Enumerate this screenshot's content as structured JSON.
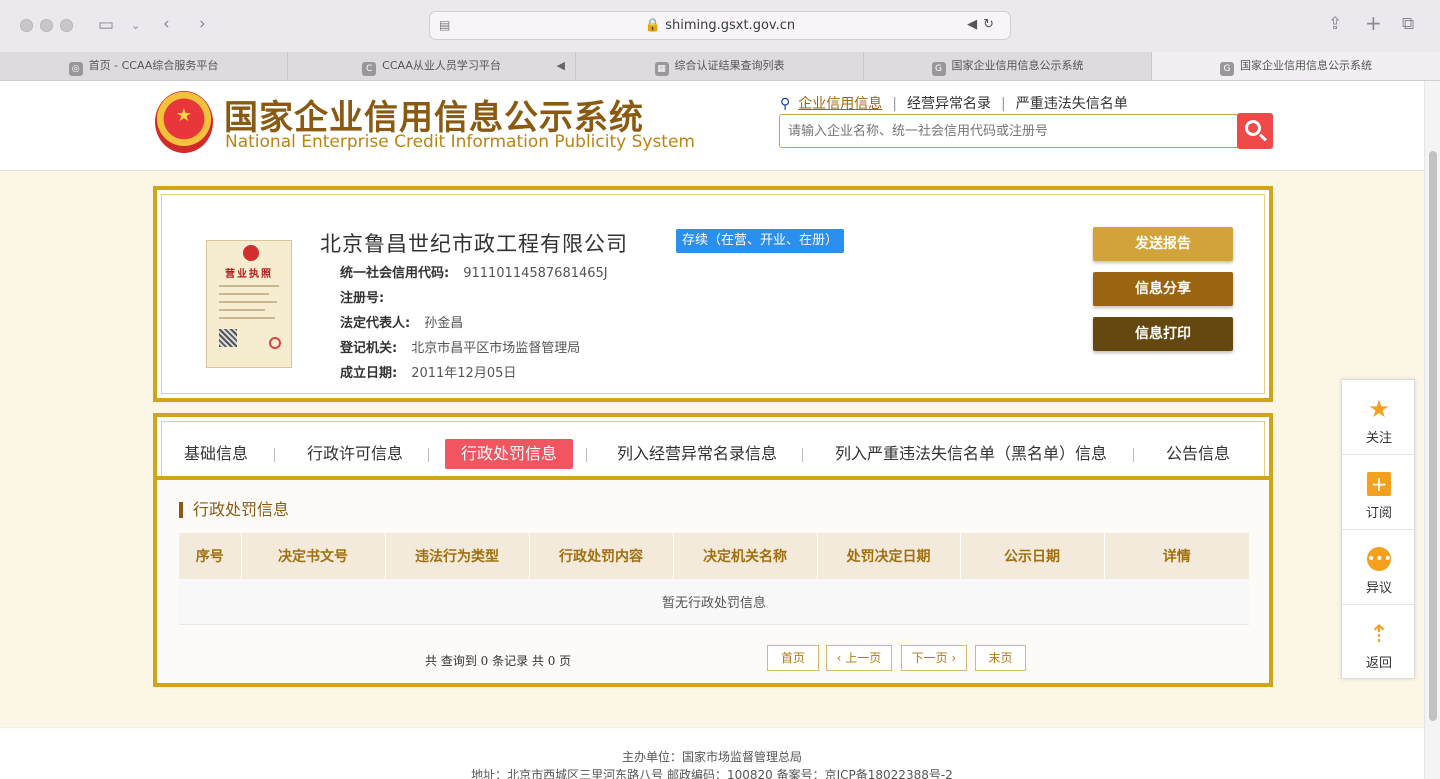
{
  "browser": {
    "url": "shiming.gsxt.gov.cn",
    "tabs": [
      {
        "label": "首页 - CCAA综合服务平台",
        "favicon": "globe-icon"
      },
      {
        "label": "CCAA从业人员学习平台",
        "favicon": "C"
      },
      {
        "label": "综合认证结果查询列表",
        "favicon": "grid-icon"
      },
      {
        "label": "国家企业信用信息公示系统",
        "favicon": "G"
      },
      {
        "label": "国家企业信用信息公示系统",
        "favicon": "G"
      }
    ]
  },
  "header": {
    "site_name_cn": "国家企业信用信息公示系统",
    "site_name_en": "National Enterprise Credit Information Publicity System",
    "search_links": [
      "企业信用信息",
      "经营异常名录",
      "严重违法失信名单"
    ],
    "search_placeholder": "请输入企业名称、统一社会信用代码或注册号"
  },
  "company": {
    "name": "北京鲁昌世纪市政工程有限公司",
    "status": "存续（在营、开业、在册）",
    "license_title": "营业执照",
    "fields": [
      {
        "key": "统一社会信用代码:",
        "value": "91110114587681465J"
      },
      {
        "key": "注册号:",
        "value": ""
      },
      {
        "key": "法定代表人:",
        "value": "孙金昌"
      },
      {
        "key": "登记机关:",
        "value": "北京市昌平区市场监督管理局"
      },
      {
        "key": "成立日期:",
        "value": "2011年12月05日"
      }
    ],
    "buttons": [
      {
        "label": "发送报告",
        "color": "#d1a33a"
      },
      {
        "label": "信息分享",
        "color": "#9a6410"
      },
      {
        "label": "信息打印",
        "color": "#654810"
      }
    ]
  },
  "nav_tabs": [
    "基础信息",
    "行政许可信息",
    "行政处罚信息",
    "列入经营异常名录信息",
    "列入严重违法失信名单（黑名单）信息",
    "公告信息"
  ],
  "content": {
    "section_title": "行政处罚信息",
    "columns": [
      "序号",
      "决定书文号",
      "违法行为类型",
      "行政处罚内容",
      "决定机关名称",
      "处罚决定日期",
      "公示日期",
      "详情"
    ],
    "empty_text": "暂无行政处罚信息",
    "record_count": "共 查询到 0 条记录 共 0 页",
    "pagination": [
      "首页",
      "上一页",
      "下一页",
      "末页"
    ]
  },
  "float_bar": [
    {
      "label": "关注",
      "icon": "star-icon"
    },
    {
      "label": "订阅",
      "icon": "subscribe-icon"
    },
    {
      "label": "异议",
      "icon": "chat-icon"
    },
    {
      "label": "返回",
      "icon": "back-top-icon"
    }
  ],
  "footer": {
    "line1": "主办单位：国家市场监督管理总局",
    "line2": "地址：北京市西城区三里河东路八号   邮政编码：100820   备案号：京ICP备18022388号-2"
  },
  "colors": {
    "gold_border": "#d1a51a",
    "brand_brown": "#8a5a12",
    "active_tab": "#f05560",
    "status_blue": "#2b8ff0",
    "search_red": "#ee4a4a"
  }
}
